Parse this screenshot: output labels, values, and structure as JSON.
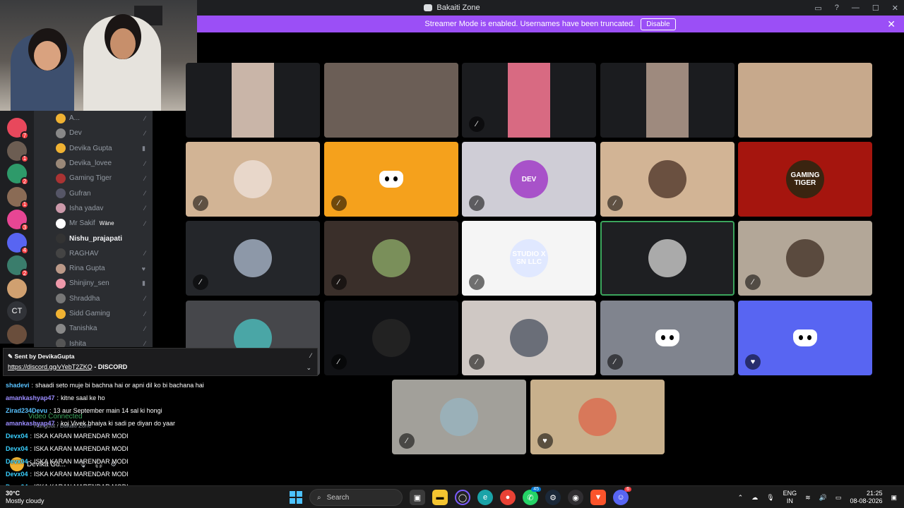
{
  "window": {
    "title": "Bakaiti Zone"
  },
  "banner": {
    "text": "Streamer Mode is enabled. Usernames have been truncated.",
    "button": "Disable"
  },
  "guilds": [
    {
      "color": "#e8485c",
      "badge": "7"
    },
    {
      "color": "#6c5d52",
      "badge": "1"
    },
    {
      "color": "#2e9a6a",
      "badge": "2"
    },
    {
      "color": "#8a6b55",
      "badge": "1"
    },
    {
      "color": "#e74694",
      "badge": "3"
    },
    {
      "color": "#5865f2",
      "badge": "4"
    },
    {
      "color": "#3a7d6c",
      "badge": "2"
    },
    {
      "color": "#d0a070",
      "badge": ""
    },
    {
      "color": "#313338",
      "label": "CT",
      "badge": ""
    },
    {
      "color": "#6a4e3c",
      "badge": ""
    }
  ],
  "members": [
    {
      "name": "A...",
      "color": "#f0b232",
      "status": "⁄",
      "active": false
    },
    {
      "name": "Dev",
      "color": "#888",
      "status": "⁄",
      "active": false
    },
    {
      "name": "Devika Gupta",
      "color": "#f0b232",
      "status": "▮",
      "active": false
    },
    {
      "name": "Devika_lovee",
      "color": "#9a8878",
      "status": "⁄",
      "active": false
    },
    {
      "name": "Gaming Tiger",
      "color": "#a33",
      "status": "⁄",
      "active": false
    },
    {
      "name": "Gufran",
      "color": "#556",
      "status": "⁄",
      "active": false
    },
    {
      "name": "Isha yadav",
      "color": "#c9a",
      "status": "⁄",
      "active": false
    },
    {
      "name": "Mr Sakif",
      "color": "#fff",
      "status": "⁄",
      "tag": "Wàne",
      "active": false
    },
    {
      "name": "Nishu_prajapati",
      "color": "#333",
      "status": "",
      "active": true
    },
    {
      "name": "RAGHAV",
      "color": "#444",
      "status": "⁄",
      "active": false
    },
    {
      "name": "Rina Gupta",
      "color": "#b98",
      "status": "♥",
      "active": false
    },
    {
      "name": "Shinjiny_sen",
      "color": "#e9a",
      "status": "▮",
      "active": false
    },
    {
      "name": "Shraddha",
      "color": "#777",
      "status": "⁄",
      "active": false
    },
    {
      "name": "Sidd Gaming",
      "color": "#f0b232",
      "status": "⁄",
      "active": false
    },
    {
      "name": "Tanishka",
      "color": "#888",
      "status": "⁄",
      "active": false
    },
    {
      "name": "Ishita",
      "color": "#555",
      "status": "⁄",
      "active": false
    }
  ],
  "tiles": [
    {
      "kind": "video",
      "bg": "#1b1c1f",
      "vcolor": "#c9b5a8",
      "mic": "",
      "speaking": false
    },
    {
      "kind": "video",
      "bg": "#5a5a5a",
      "vcolor": "#6b5e56",
      "mic": "",
      "speaking": false,
      "wide": true
    },
    {
      "kind": "video",
      "bg": "#1b1c1f",
      "vcolor": "#d86a82",
      "mic": "⁄",
      "speaking": false
    },
    {
      "kind": "video",
      "bg": "#1b1c1f",
      "vcolor": "#9e8a7e",
      "mic": "",
      "speaking": false
    },
    {
      "kind": "video",
      "bg": "#8a7a6a",
      "vcolor": "#c7a98c",
      "mic": "",
      "speaking": false,
      "wide": true
    },
    {
      "kind": "avatar",
      "bg": "#d2b495",
      "acolor": "#e8d7ca",
      "mic": "⁄",
      "speaking": false
    },
    {
      "kind": "discord",
      "bg": "#f5a11c",
      "mic": "⁄",
      "speaking": false
    },
    {
      "kind": "avatar",
      "bg": "#cfcdd6",
      "acolor": "#a852c9",
      "label": "DEV",
      "mic": "⁄",
      "speaking": false
    },
    {
      "kind": "avatar",
      "bg": "#d2b495",
      "acolor": "#6a5040",
      "mic": "⁄",
      "speaking": false
    },
    {
      "kind": "avatar",
      "bg": "#a5150e",
      "acolor": "#3a2410",
      "label": "GAMING TIGER",
      "mic": "",
      "speaking": false
    },
    {
      "kind": "avatar",
      "bg": "#24262a",
      "acolor": "#8d98a8",
      "mic": "⁄",
      "speaking": false
    },
    {
      "kind": "avatar",
      "bg": "#3a2f2a",
      "acolor": "#7a8f5a",
      "mic": "⁄",
      "speaking": false
    },
    {
      "kind": "avatar",
      "bg": "#f5f5f5",
      "acolor": "#e0e8ff",
      "label": "STUDIO X SN LLC",
      "mic": "⁄",
      "speaking": false
    },
    {
      "kind": "avatar",
      "bg": "#1e1f22",
      "acolor": "#aaa",
      "mic": "",
      "speaking": true
    },
    {
      "kind": "avatar",
      "bg": "#b3a798",
      "acolor": "#5a4a3e",
      "mic": "⁄",
      "speaking": false
    },
    {
      "kind": "avatar",
      "bg": "#46474b",
      "acolor": "#4aa6a6",
      "mic": "",
      "speaking": false
    },
    {
      "kind": "avatar",
      "bg": "#111215",
      "acolor": "#222",
      "mic": "⁄",
      "speaking": false
    },
    {
      "kind": "avatar",
      "bg": "#cfc8c4",
      "acolor": "#6a6e78",
      "mic": "⁄",
      "speaking": false
    },
    {
      "kind": "discord",
      "bg": "#80848e",
      "mic": "⁄",
      "speaking": false
    },
    {
      "kind": "discord",
      "bg": "#5865f2",
      "mic": "♥",
      "speaking": false
    },
    {
      "kind": "avatar",
      "bg": "#a2a09a",
      "acolor": "#9ab0b8",
      "mic": "⁄",
      "speaking": false
    },
    {
      "kind": "avatar",
      "bg": "#c8b08c",
      "acolor": "#d8785a",
      "mic": "♥",
      "speaking": false
    }
  ],
  "popup": {
    "sent_by": "Sent by",
    "sender": "DevikaGupta",
    "link": "https://discord.gg/vYebT2ZKQ",
    "suffix": " - DISCORD"
  },
  "chat": [
    {
      "user": "shadevi",
      "ucolor": "#59c2ff",
      "text": "shaadi seto muje bi bachna hai or apni dil ko bi bachana hai"
    },
    {
      "user": "amankashyap47",
      "ucolor": "#9b8cff",
      "text": "kitne saal ke ho"
    },
    {
      "user": "Zirad234Devu",
      "ucolor": "#59c2ff",
      "text": "13 aur September main 14 sal ki hongi"
    },
    {
      "user": "amankashyap47",
      "ucolor": "#9b8cff",
      "text": "koi Vivek bhaiya ki sadi pe diyan do yaar"
    },
    {
      "user": "Devx04",
      "ucolor": "#3ad0ff",
      "text": "ISKA KARAN MARENDAR MODI"
    },
    {
      "user": "Devx04",
      "ucolor": "#3ad0ff",
      "text": "ISKA KARAN MARENDAR MODI"
    },
    {
      "user": "Devx04",
      "ucolor": "#3ad0ff",
      "text": "ISKA KARAN MARENDAR MODI"
    },
    {
      "user": "Devx04",
      "ucolor": "#3ad0ff",
      "text": "ISKA KARAN MARENDAR MODI"
    },
    {
      "user": "Devx04",
      "ucolor": "#3ad0ff",
      "text": "ISKA KARAN MARENDAR MODI"
    }
  ],
  "voice": {
    "status": "Video Connected",
    "sub": "Hangout / Bakaiti Zone",
    "user": "Devika Gu..."
  },
  "taskbar": {
    "weather_temp": "30°C",
    "weather_text": "Mostly cloudy",
    "search": "Search",
    "badge_whatsapp": "45",
    "badge_discord": "6",
    "lang1": "ENG",
    "lang2": "IN",
    "time": "21:25",
    "date": "08-08-2026"
  }
}
